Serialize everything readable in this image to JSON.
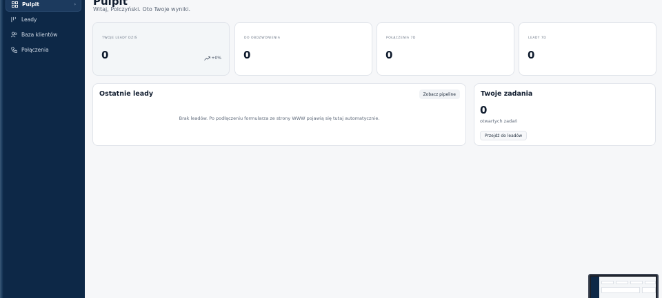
{
  "sidebar": {
    "items": [
      {
        "label": "Pulpit",
        "icon": "dashboard-icon",
        "active": true
      },
      {
        "label": "Leady",
        "icon": "leads-icon",
        "active": false
      },
      {
        "label": "Baza klientów",
        "icon": "users-icon",
        "active": false
      },
      {
        "label": "Połączenia",
        "icon": "phone-icon",
        "active": false
      }
    ]
  },
  "header": {
    "title": "Pulpit",
    "subtitle": "Witaj, Polczyński. Oto Twoje wyniki."
  },
  "stats": [
    {
      "label": "Twoje leady dziś",
      "value": "0",
      "trend": "+0%"
    },
    {
      "label": "Do obdzwonienia",
      "value": "0"
    },
    {
      "label": "Połączenia 7d",
      "value": "0"
    },
    {
      "label": "Leady 7d",
      "value": "0"
    }
  ],
  "recent_leads": {
    "title": "Ostatnie leady",
    "button_label": "Zobacz pipeline",
    "empty_message": "Brak leadów. Po podłączeniu formularza ze strony WWW pojawią się tutaj automatycznie."
  },
  "tasks": {
    "title": "Twoje zadania",
    "count": "0",
    "count_label": "otwartych zadań",
    "button_label": "Przejdź do leadów"
  },
  "colors": {
    "sidebar_bg": "#0d2847",
    "page_bg": "#f6f7f9",
    "card_bg": "#ffffff"
  }
}
